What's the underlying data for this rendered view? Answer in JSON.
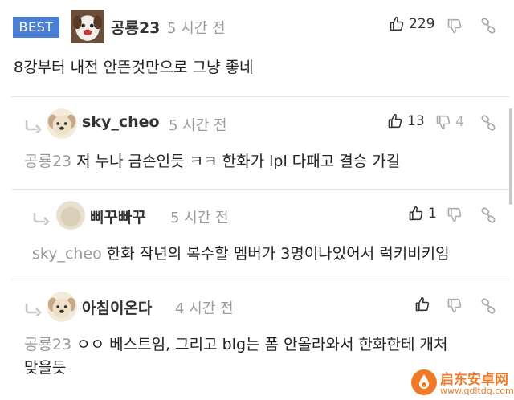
{
  "comments": [
    {
      "badge": "BEST",
      "nick": "공룡23",
      "time": "5 시간 전",
      "likes": "229",
      "text": "8강부터 내전 안뜬것만으로 그냥 좋네"
    },
    {
      "nick": "sky_cheo",
      "time": "5 시간 전",
      "likes": "13",
      "dislikes": "4",
      "mention": "공룡23",
      "text": "저 누나 금손인듯 ㅋㅋ 한화가 lpl 다패고 결승 가길"
    },
    {
      "nick": "삐꾸빠꾸",
      "time": "5 시간 전",
      "likes": "1",
      "mention": "sky_cheo",
      "text": "한화 작년의 복수할 멤버가 3명이나있어서 럭키비키임"
    },
    {
      "nick": "아침이온다",
      "time": "4 시간 전",
      "mention": "공룡23",
      "text_line1": "ㅇㅇ 베스트임, 그리고 blg는 폼 안올라와서 한화한테 개처",
      "text_line2": "맞을듯"
    }
  ],
  "icons": {
    "like": "thumbs-up-icon",
    "dislike": "thumbs-down-icon",
    "share": "link-icon",
    "reply": "reply-arrow-icon"
  },
  "colors": {
    "best_badge": "#4a7fd6",
    "meta_grey": "#9a9a9a",
    "watermark": "#f07a28"
  },
  "watermark": {
    "line1": "启东安卓网",
    "line2": "www.qdltdq.com"
  }
}
